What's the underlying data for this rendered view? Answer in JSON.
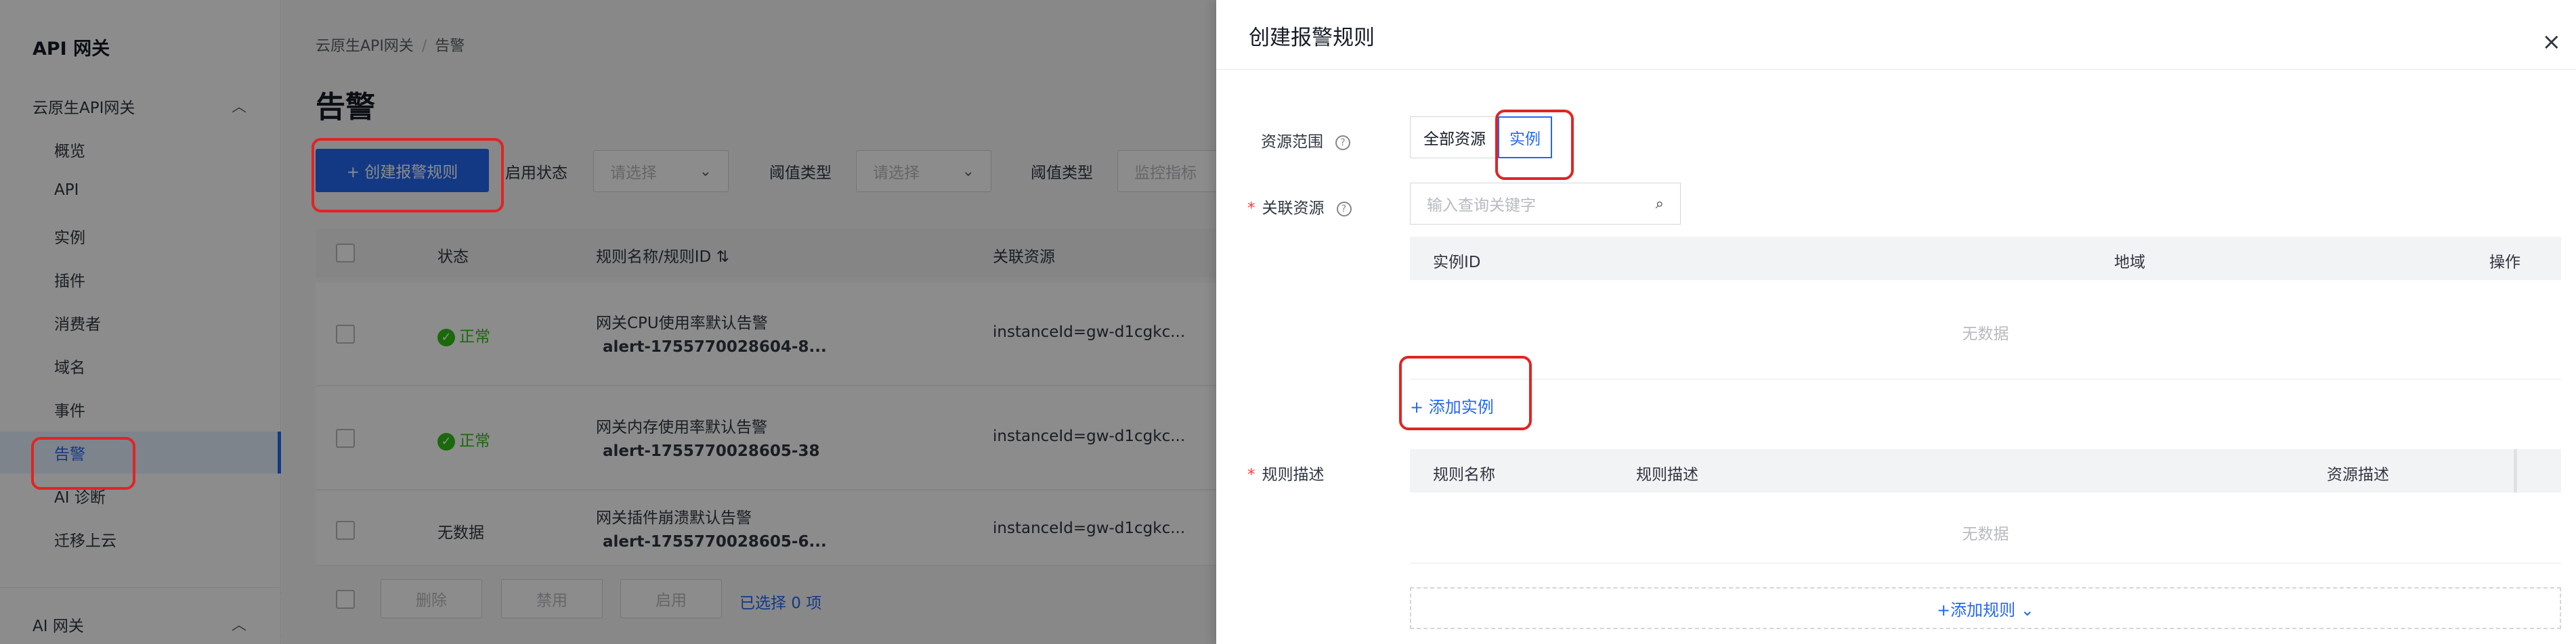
{
  "sidebar": {
    "title": "API 网关",
    "group1": "云原生API网关",
    "items": [
      "概览",
      "API",
      "实例",
      "插件",
      "消费者",
      "域名",
      "事件",
      "告警",
      "AI 诊断",
      "迁移上云"
    ],
    "group2": "AI 网关"
  },
  "main": {
    "breadcrumb": [
      "云原生API网关",
      "告警"
    ],
    "title": "告警",
    "create_button": "+ 创建报警规则",
    "filters": [
      {
        "label": "启用状态",
        "placeholder": "请选择"
      },
      {
        "label": "阈值类型",
        "placeholder": "请选择"
      },
      {
        "label": "阈值类型",
        "placeholder": "监控指标"
      }
    ],
    "columns": [
      "状态",
      "规则名称/规则ID",
      "关联资源"
    ],
    "rows": [
      {
        "status": "正常",
        "name": "网关CPU使用率默认告警",
        "id": "alert-1755770028604-8...",
        "resource": "instanceId=gw-d1cgkc..."
      },
      {
        "status": "正常",
        "name": "网关内存使用率默认告警",
        "id": "alert-1755770028605-38",
        "resource": "instanceId=gw-d1cgkc..."
      },
      {
        "status": "无数据",
        "name": "网关插件崩溃默认告警",
        "id": "alert-1755770028605-6...",
        "resource": "instanceId=gw-d1cgkc..."
      }
    ],
    "footer": {
      "delete": "删除",
      "disable": "禁用",
      "enable": "启用",
      "selected": "已选择 0 项"
    }
  },
  "drawer": {
    "title": "创建报警规则",
    "resource_scope": {
      "label": "资源范围",
      "options": [
        "全部资源",
        "实例"
      ],
      "selected": "实例"
    },
    "linked_resource": {
      "label": "关联资源",
      "placeholder": "输入查询关键字"
    },
    "instance_table": {
      "columns": [
        "实例ID",
        "地域",
        "操作"
      ],
      "empty": "无数据"
    },
    "add_instance": "+ 添加实例",
    "rule_desc": {
      "label": "规则描述",
      "columns": [
        "规则名称",
        "规则描述",
        "资源描述"
      ],
      "empty": "无数据"
    },
    "add_rule": "+添加规则 ⌄"
  },
  "colors": {
    "primary": "#2468f2",
    "success": "#30bf13",
    "required": "#f33e3e",
    "highlight": "#e02424"
  }
}
